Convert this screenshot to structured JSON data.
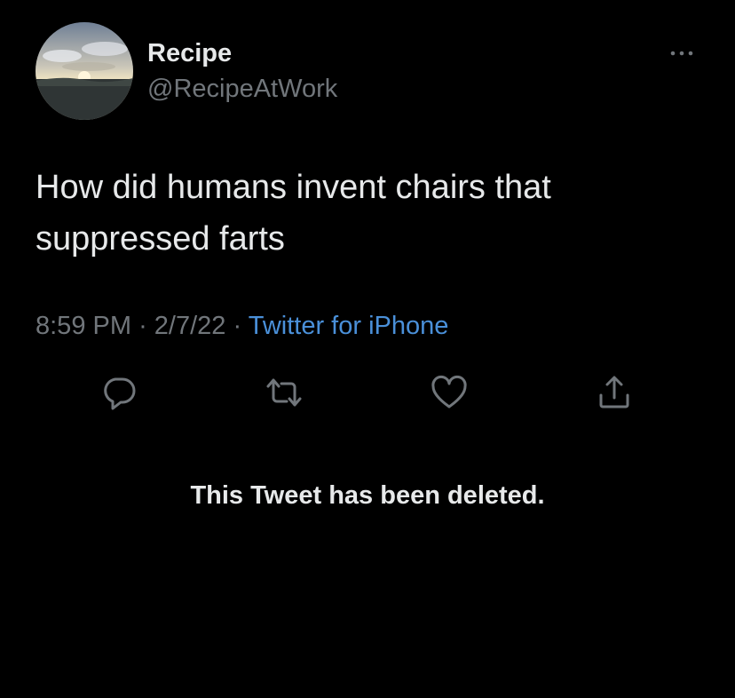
{
  "tweet": {
    "author": {
      "display_name": "Recipe",
      "handle": "@RecipeAtWork"
    },
    "text": "How did humans invent chairs that suppressed farts",
    "time": "8:59 PM",
    "separator": "·",
    "date": "2/7/22",
    "source": "Twitter for iPhone",
    "actions": [
      {
        "name": "reply",
        "icon": "reply-icon"
      },
      {
        "name": "retweet",
        "icon": "retweet-icon"
      },
      {
        "name": "like",
        "icon": "heart-icon"
      },
      {
        "name": "share",
        "icon": "share-icon"
      }
    ]
  },
  "reply_notice": "This Tweet has been deleted.",
  "colors": {
    "background": "#000000",
    "primary_text": "#e7e9ea",
    "secondary_text": "#71767b",
    "link": "#4a90d9"
  }
}
